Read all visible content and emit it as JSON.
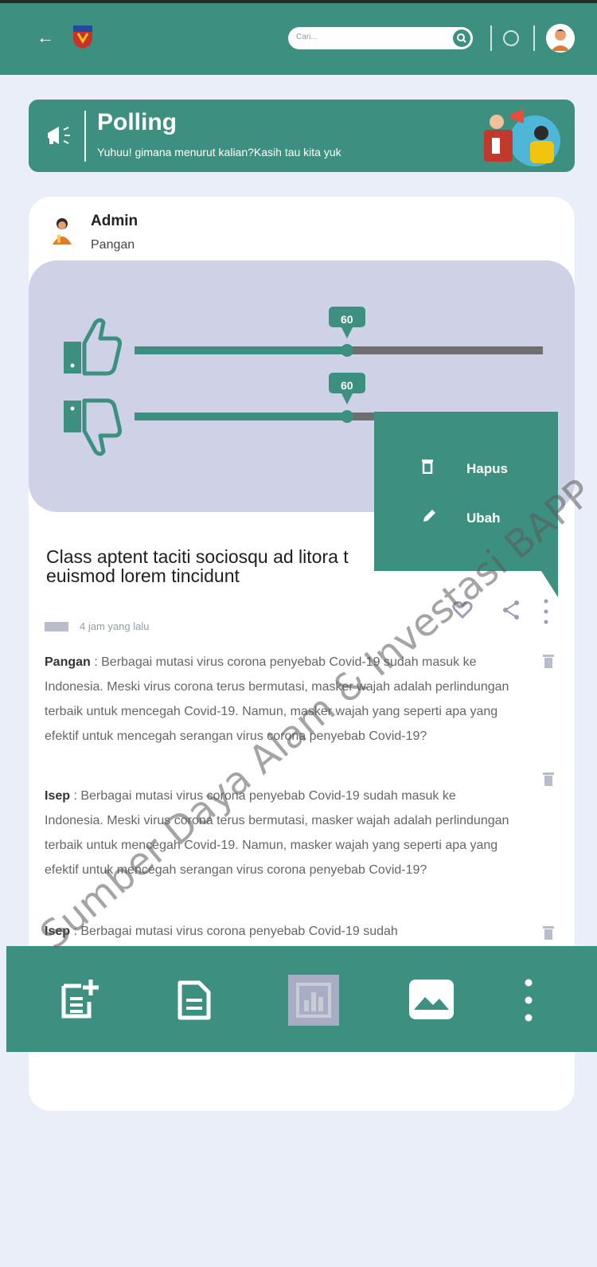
{
  "header": {
    "search_placeholder": "Cari..."
  },
  "banner": {
    "title": "Polling",
    "subtitle": "Yuhuu! gimana menurut kalian?Kasih tau kita yuk"
  },
  "post": {
    "author": "Admin",
    "category": "Pangan",
    "poll": {
      "like_value": "60",
      "dislike_value": "60",
      "like_fraction": 0.52,
      "dislike_fraction": 0.52
    },
    "title": "Class aptent taciti sociosqu ad litora t... euismod lorem tincidunt",
    "title_line1": "Class aptent taciti sociosqu ad litora t",
    "title_line2": "euismod lorem tincidunt",
    "time": "4 jam yang lalu"
  },
  "menu": {
    "delete_label": "Hapus",
    "edit_label": "Ubah"
  },
  "comments": [
    {
      "name": "Pangan",
      "text": " : Berbagai mutasi virus corona penyebab Covid-19 sudah masuk ke Indonesia. Meski virus corona terus bermutasi, masker wajah adalah perlindungan terbaik untuk mencegah Covid-19. Namun, masker wajah yang seperti apa yang efektif untuk mencegah serangan virus corona penyebab Covid-19?"
    },
    {
      "name": "Isep",
      "text": " : Berbagai mutasi virus corona penyebab Covid-19 sudah masuk ke Indonesia. Meski virus corona terus bermutasi, masker wajah adalah perlindungan terbaik untuk mencegah Covid-19. Namun, masker wajah yang seperti apa yang efektif untuk mencegah serangan virus corona penyebab Covid-19?"
    },
    {
      "name": "Isep",
      "text": " : Berbagai mutasi virus corona penyebab Covid-19 sudah"
    }
  ],
  "watermark": "Sumber Daya Alam & Investasi BAPP",
  "colors": {
    "primary": "#3d9080",
    "poll_bg": "#cfd2e6",
    "page_bg": "#e9eef8"
  }
}
